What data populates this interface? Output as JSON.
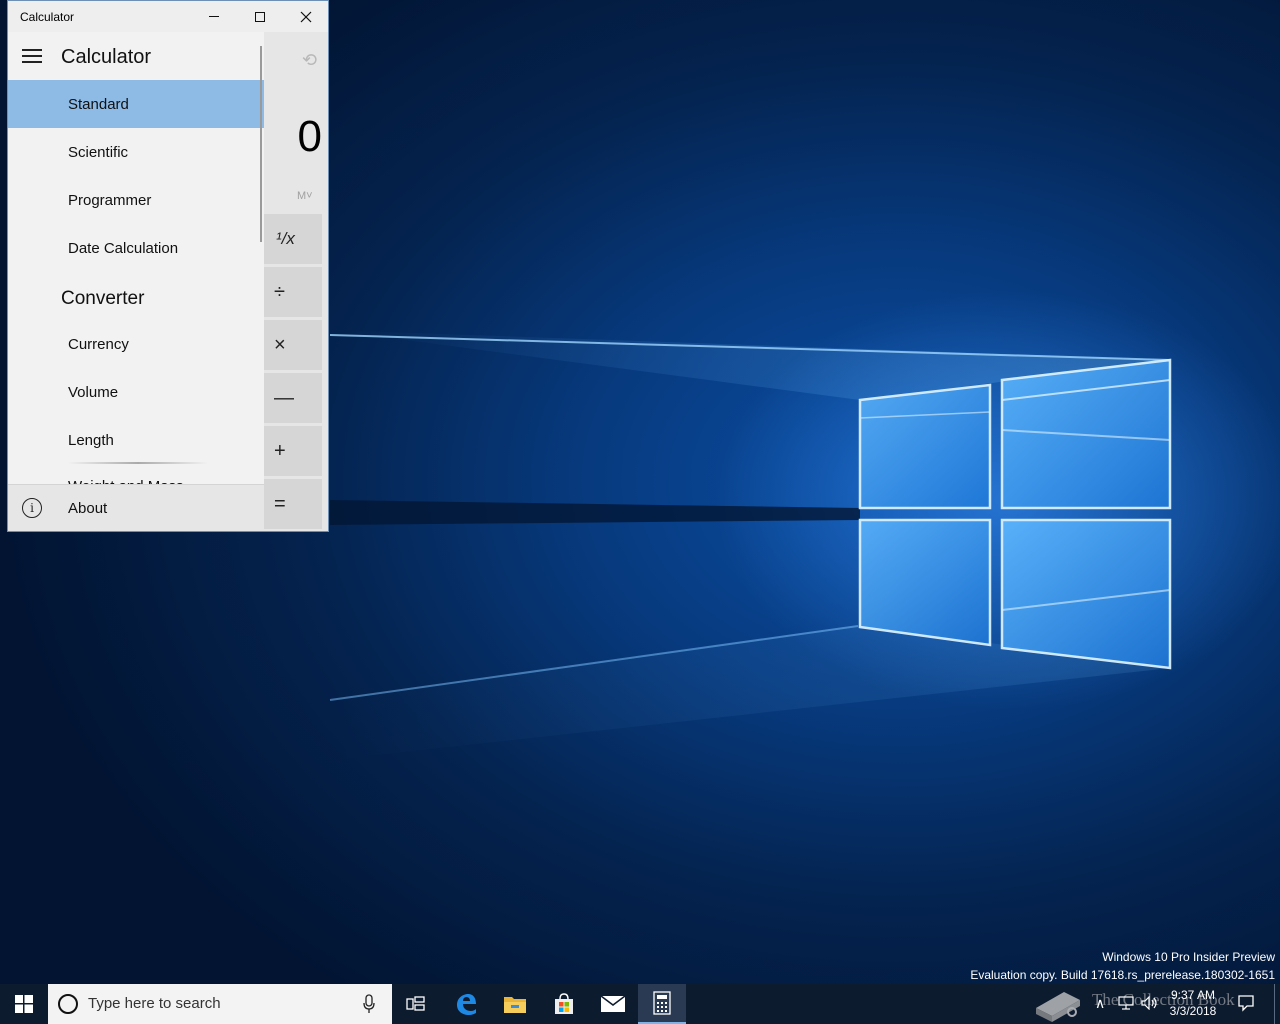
{
  "window": {
    "title": "Calculator",
    "minimize_icon": "minimize-icon",
    "maximize_icon": "maximize-icon",
    "close_icon": "close-icon"
  },
  "calculator": {
    "display": "0",
    "memory_label": "M˅",
    "operators": [
      "¹/x",
      "÷",
      "×",
      "—",
      "+",
      "="
    ]
  },
  "nav": {
    "title": "Calculator",
    "calculator_items": [
      {
        "label": "Standard",
        "selected": true
      },
      {
        "label": "Scientific",
        "selected": false
      },
      {
        "label": "Programmer",
        "selected": false
      },
      {
        "label": "Date Calculation",
        "selected": false
      }
    ],
    "converter_header": "Converter",
    "converter_items": [
      {
        "label": "Currency"
      },
      {
        "label": "Volume"
      },
      {
        "label": "Length"
      },
      {
        "label": "Weight and Mass"
      }
    ],
    "about_label": "About",
    "selection_color": "#8dbbe6"
  },
  "desktop": {
    "watermark_line1": "Windows 10 Pro Insider Preview",
    "watermark_line2": "Evaluation copy. Build 17618.rs_prerelease.180302-1651"
  },
  "taskbar": {
    "search_placeholder": "Type here to search",
    "pinned": [
      "task-view-icon",
      "edge-icon",
      "file-explorer-icon",
      "store-icon",
      "mail-icon",
      "calculator-icon"
    ],
    "time": "9:37 AM",
    "date": "3/3/2018",
    "overlay_text": "The Collection Book"
  }
}
